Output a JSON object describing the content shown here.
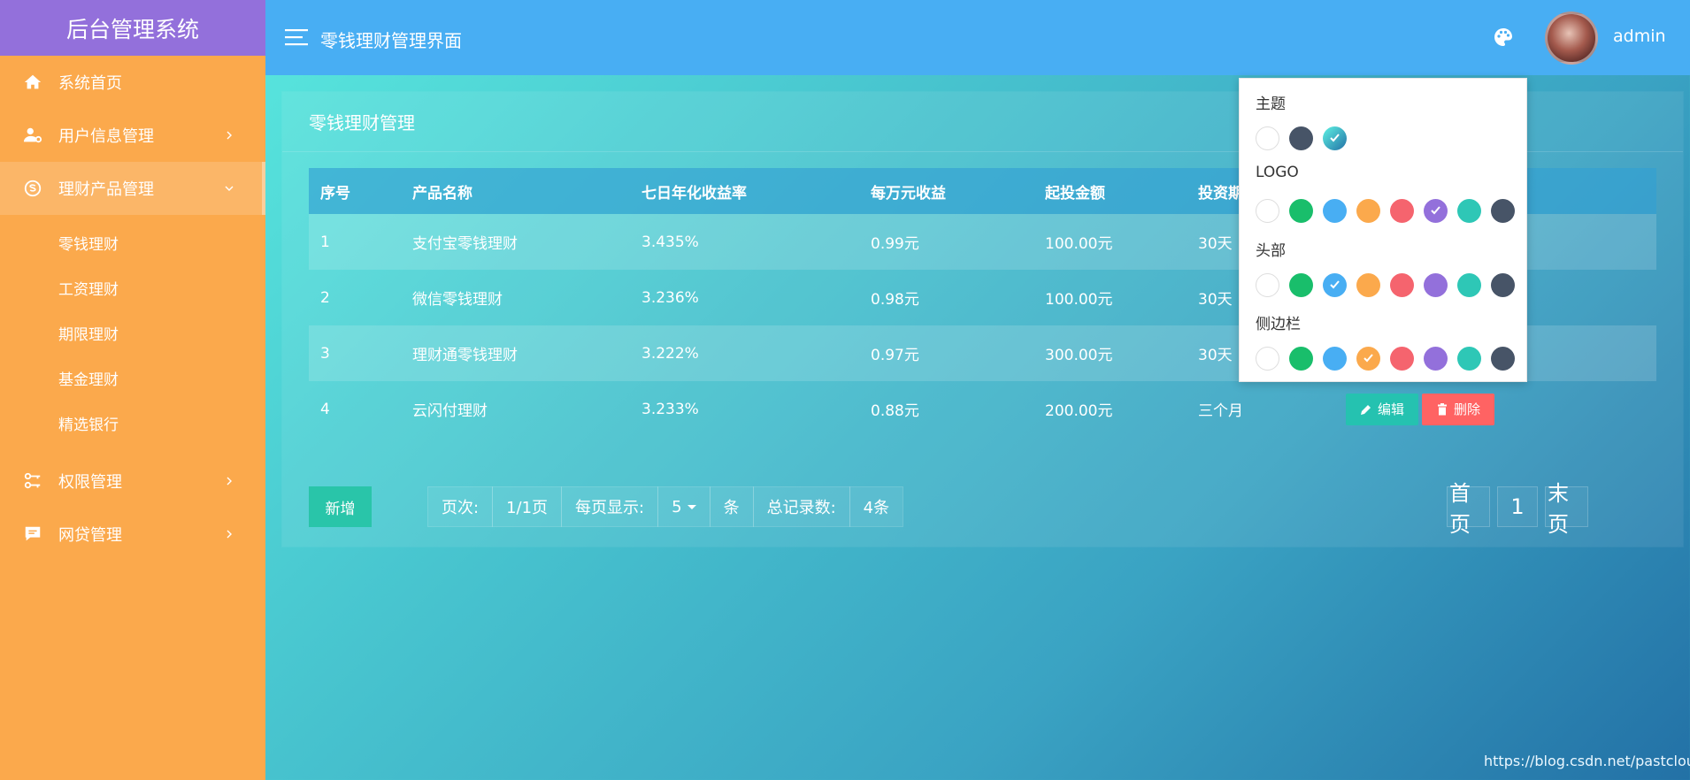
{
  "app": {
    "logo": "后台管理系统"
  },
  "sidebar": {
    "items": [
      {
        "label": "系统首页",
        "icon": "home-icon"
      },
      {
        "label": "用户信息管理",
        "icon": "user-gear-icon"
      },
      {
        "label": "理财产品管理",
        "icon": "skype-icon",
        "expanded": true
      },
      {
        "label": "权限管理",
        "icon": "key-icon"
      },
      {
        "label": "网贷管理",
        "icon": "comment-icon"
      }
    ],
    "submenu": [
      "零钱理财",
      "工资理财",
      "期限理财",
      "基金理财",
      "精选银行"
    ]
  },
  "header": {
    "title": "零钱理财管理界面",
    "username": "admin"
  },
  "card": {
    "title": "零钱理财管理",
    "columns": [
      "序号",
      "产品名称",
      "七日年化收益率",
      "每万元收益",
      "起投金额",
      "投资期"
    ],
    "rows": [
      {
        "no": "1",
        "name": "支付宝零钱理财",
        "rate": "3.435%",
        "income": "0.99元",
        "min": "100.00元",
        "term": "30天"
      },
      {
        "no": "2",
        "name": "微信零钱理财",
        "rate": "3.236%",
        "income": "0.98元",
        "min": "100.00元",
        "term": "30天"
      },
      {
        "no": "3",
        "name": "理财通零钱理财",
        "rate": "3.222%",
        "income": "0.97元",
        "min": "300.00元",
        "term": "30天"
      },
      {
        "no": "4",
        "name": "云闪付理财",
        "rate": "3.233%",
        "income": "0.88元",
        "min": "200.00元",
        "term": "三个月"
      }
    ],
    "edit_label": "编辑",
    "delete_label": "删除",
    "add_label": "新增"
  },
  "pagination": {
    "page_label": "页次:",
    "page_value": "1/1页",
    "per_page_label": "每页显示:",
    "per_page_value": "5",
    "unit": "条",
    "total_label": "总记录数:",
    "total_value": "4条",
    "first": "首页",
    "current": "1",
    "last": "末页"
  },
  "theme_panel": {
    "sections": [
      "主题",
      "LOGO",
      "头部",
      "侧边栏"
    ],
    "theme_colors": [
      "#ffffff",
      "#475467",
      "#3cc3d6"
    ],
    "palette_colors": [
      "#ffffff",
      "#19be6b",
      "#48aef3",
      "#fba94c",
      "#f5646e",
      "#9370db",
      "#2ec7b6",
      "#475467"
    ]
  },
  "watermark": "https://blog.csdn.net/pastclouds"
}
